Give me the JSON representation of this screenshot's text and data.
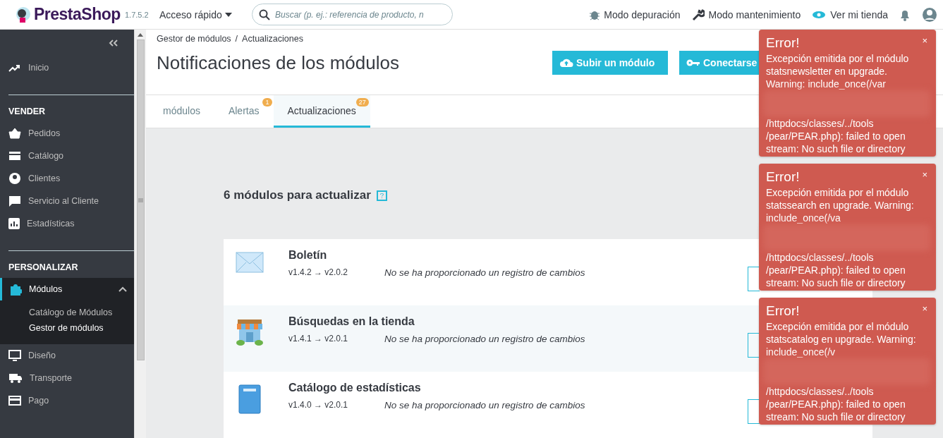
{
  "header": {
    "logo": "PrestaShop",
    "version": "1.7.5.2",
    "quick_access": "Acceso rápido",
    "search": {
      "placeholder": "Buscar (p. ej.: referencia de producto, n"
    },
    "actions": [
      {
        "kind": "debug",
        "label": "Modo depuración"
      },
      {
        "kind": "maintenance",
        "label": "Modo mantenimiento"
      },
      {
        "kind": "shop",
        "label": "Ver mi tienda"
      }
    ]
  },
  "sidebar": {
    "sections": [
      {
        "items": [
          {
            "kind": "home",
            "label": "Inicio",
            "selected": false
          }
        ]
      },
      {
        "title": "VENDER",
        "items": [
          {
            "kind": "orders",
            "label": "Pedidos",
            "selected": false
          },
          {
            "kind": "catalog",
            "label": "Catálogo",
            "selected": false
          },
          {
            "kind": "customers",
            "label": "Clientes",
            "selected": false
          },
          {
            "kind": "service",
            "label": "Servicio al Cliente",
            "selected": false
          },
          {
            "kind": "stats",
            "label": "Estadísticas",
            "selected": false
          }
        ]
      },
      {
        "title": "PERSONALIZAR",
        "items": [
          {
            "kind": "modules",
            "label": "Módulos",
            "selected": true,
            "expanded": true,
            "children": [
              {
                "label": "Catálogo de Módulos",
                "selected": false
              },
              {
                "label": "Gestor de módulos",
                "selected": true
              }
            ]
          },
          {
            "kind": "design",
            "label": "Diseño",
            "selected": false
          },
          {
            "kind": "shipping",
            "label": "Transporte",
            "selected": false
          },
          {
            "kind": "payment",
            "label": "Pago",
            "selected": false
          }
        ]
      }
    ]
  },
  "breadcrumb": [
    "Gestor de módulos",
    "Actualizaciones"
  ],
  "breadcrumb_separator": "/",
  "page_title": "Notificaciones de los módulos",
  "toolbar_buttons": [
    {
      "kind": "upload",
      "label": "Subir un módulo"
    },
    {
      "kind": "connect",
      "label": "Conectarse"
    }
  ],
  "tabs": [
    {
      "label": "módulos",
      "selected": false
    },
    {
      "label": "Alertas",
      "badge": "1",
      "selected": false
    },
    {
      "label": "Actualizaciones",
      "badge": "27",
      "selected": true
    }
  ],
  "section_heading": "6 módulos para actualizar",
  "modules": [
    {
      "kind": "newsletter",
      "name": "Boletín",
      "versions": "v1.4.2 → v2.0.2",
      "changelog": "No se ha proporcionado un registro de cambios"
    },
    {
      "kind": "store",
      "name": "Búsquedas en la tienda",
      "versions": "v1.4.1 → v2.0.1",
      "changelog": "No se ha proporcionado un registro de cambios"
    },
    {
      "kind": "book",
      "name": "Catálogo de estadísticas",
      "versions": "v1.4.0 → v2.0.1",
      "changelog": "No se ha proporcionado un registro de cambios"
    }
  ],
  "notifications": [
    {
      "title": "Error!",
      "close": "×",
      "message_start": "Excepción emitida por el módulo statsnewsletter en upgrade. Warning: include_once(/var",
      "message_end": "/httpdocs/classes/../tools /pear/PEAR.php): failed to open stream: No such file or directory"
    },
    {
      "title": "Error!",
      "close": "×",
      "message_start": "Excepción emitida por el módulo statssearch en upgrade. Warning: include_once(/va",
      "message_end": "/httpdocs/classes/../tools /pear/PEAR.php): failed to open stream: No such file or directory"
    },
    {
      "title": "Error!",
      "close": "×",
      "message_start": "Excepción emitida por el módulo statscatalog en upgrade. Warning: include_once(/v",
      "message_end": "/httpdocs/classes/../tools /pear/PEAR.php): failed to open stream: No such file or directory"
    }
  ]
}
